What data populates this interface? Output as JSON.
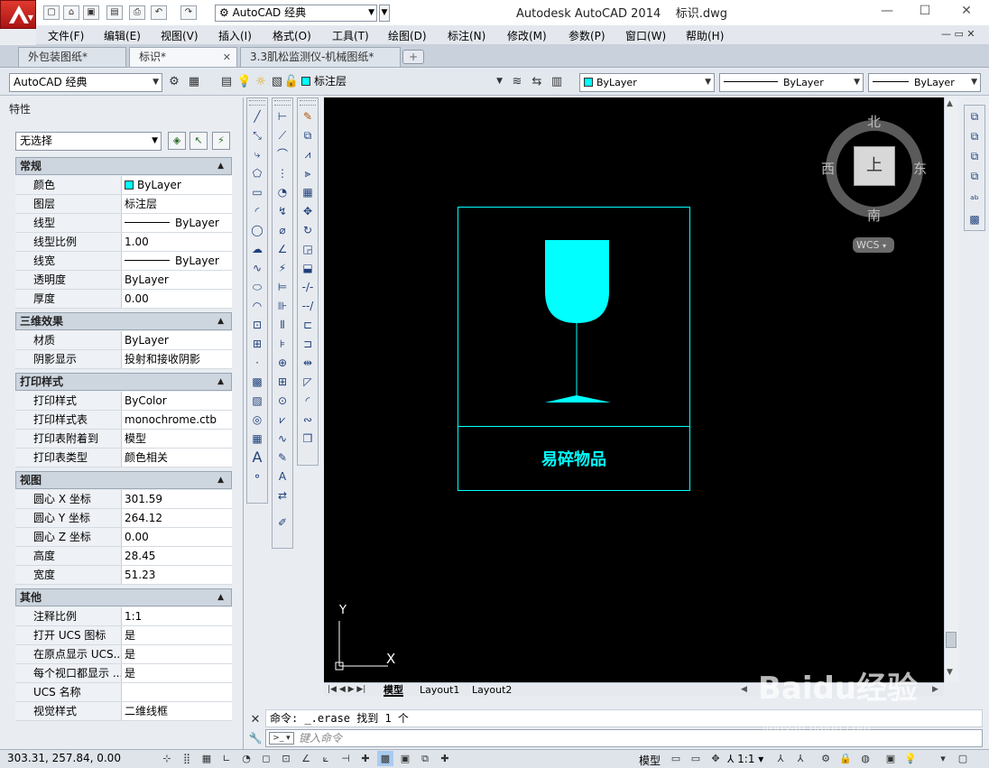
{
  "titlebar": {
    "workspace": "AutoCAD 经典",
    "app_title": "Autodesk AutoCAD 2014",
    "file_name": "标识.dwg"
  },
  "menus": [
    "文件(F)",
    "编辑(E)",
    "视图(V)",
    "插入(I)",
    "格式(O)",
    "工具(T)",
    "绘图(D)",
    "标注(N)",
    "修改(M)",
    "参数(P)",
    "窗口(W)",
    "帮助(H)"
  ],
  "tabs": [
    {
      "label": "外包装图纸*",
      "active": false
    },
    {
      "label": "标识*",
      "active": true
    },
    {
      "label": "3.3肌松监测仪-机械图纸*",
      "active": false
    }
  ],
  "toolbar": {
    "workspace_combo": "AutoCAD 经典",
    "layer_combo": "标注层",
    "color_combo": "ByLayer",
    "linetype_combo": "ByLayer",
    "lineweight_combo": "ByLayer"
  },
  "properties": {
    "title": "特性",
    "selection": "无选择",
    "sections": [
      {
        "title": "常规",
        "rows": [
          {
            "label": "颜色",
            "value": "ByLayer"
          },
          {
            "label": "图层",
            "value": "标注层"
          },
          {
            "label": "线型",
            "value": "ByLayer"
          },
          {
            "label": "线型比例",
            "value": "1.00"
          },
          {
            "label": "线宽",
            "value": "ByLayer"
          },
          {
            "label": "透明度",
            "value": "ByLayer"
          },
          {
            "label": "厚度",
            "value": "0.00"
          }
        ]
      },
      {
        "title": "三维效果",
        "rows": [
          {
            "label": "材质",
            "value": "ByLayer"
          },
          {
            "label": "阴影显示",
            "value": "投射和接收阴影"
          }
        ]
      },
      {
        "title": "打印样式",
        "rows": [
          {
            "label": "打印样式",
            "value": "ByColor"
          },
          {
            "label": "打印样式表",
            "value": "monochrome.ctb"
          },
          {
            "label": "打印表附着到",
            "value": "模型"
          },
          {
            "label": "打印表类型",
            "value": "颜色相关"
          }
        ]
      },
      {
        "title": "视图",
        "rows": [
          {
            "label": "圆心 X 坐标",
            "value": "301.59"
          },
          {
            "label": "圆心 Y 坐标",
            "value": "264.12"
          },
          {
            "label": "圆心 Z 坐标",
            "value": "0.00"
          },
          {
            "label": "高度",
            "value": "28.45"
          },
          {
            "label": "宽度",
            "value": "51.23"
          }
        ]
      },
      {
        "title": "其他",
        "rows": [
          {
            "label": "注释比例",
            "value": "1:1"
          },
          {
            "label": "打开 UCS 图标",
            "value": "是"
          },
          {
            "label": "在原点显示 UCS...",
            "value": "是"
          },
          {
            "label": "每个视口都显示 ...",
            "value": "是"
          },
          {
            "label": "UCS 名称",
            "value": ""
          },
          {
            "label": "视觉样式",
            "value": "二维线框"
          }
        ]
      }
    ]
  },
  "drawing": {
    "label_text": "易碎物品",
    "accent": "#00ffff"
  },
  "viewcube": {
    "north": "北",
    "south": "南",
    "east": "东",
    "west": "西",
    "face": "上",
    "wcs": "WCS"
  },
  "layout_tabs": [
    "模型",
    "Layout1",
    "Layout2"
  ],
  "ucs_axes": {
    "x": "X",
    "y": "Y"
  },
  "command": {
    "history": "命令: _.erase 找到 1 个",
    "placeholder": "键入命令"
  },
  "status": {
    "coords": "303.31, 257.84, 0.00",
    "model": "模型",
    "scale": "1:1"
  },
  "watermark": {
    "main": "Baidu经验",
    "sub": "jingyan.baidu.com"
  }
}
